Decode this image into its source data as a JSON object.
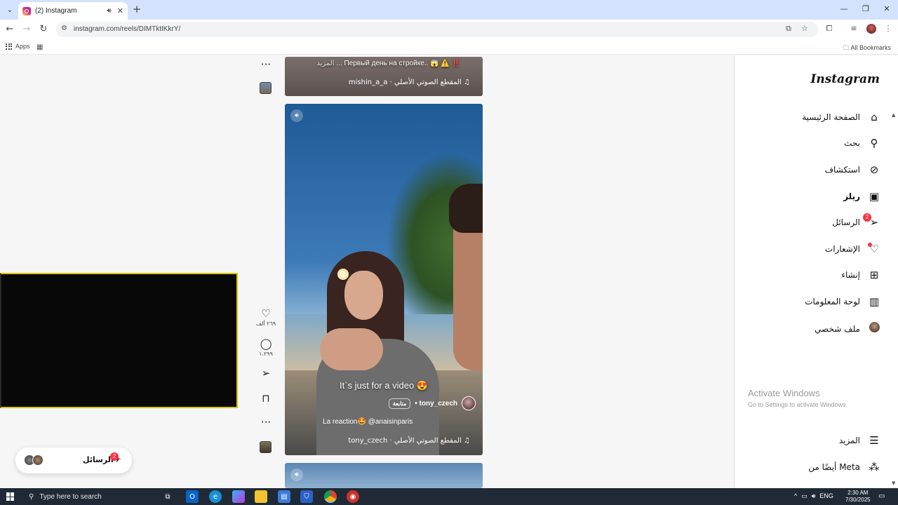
{
  "browser": {
    "tab_title": "(2) Instagram",
    "url": "instagram.com/reels/DIMTktIKkrY/",
    "bookmarks": {
      "apps_label": "Apps",
      "all_bookmarks_label": "All Bookmarks"
    }
  },
  "reels": {
    "previous": {
      "caption": "Первый день на стройке.. 😱 ⚠️ ‼️",
      "more_label": "المزيد ...",
      "audio": "mishin_a_a · المقطع الصوتي الأصلي ♫"
    },
    "current": {
      "overlay_text": "It`s just for a video 😍",
      "author": "tony_czech",
      "follow_label": "متابعة",
      "sub_caption": "La reaction🤩 @anaisinparis",
      "audio": "tony_czech · المقطع الصوتي الأصلي ♫",
      "likes": "٢٦٩ ألف",
      "comments": "١،٢٩٩"
    }
  },
  "sidebar": {
    "logo": "Instagram",
    "items": [
      {
        "label": "الصفحة الرئيسية",
        "icon": "home-icon"
      },
      {
        "label": "بحث",
        "icon": "search-icon"
      },
      {
        "label": "استكشاف",
        "icon": "explore-icon"
      },
      {
        "label": "ريلز",
        "icon": "reels-icon"
      },
      {
        "label": "الرسائل",
        "icon": "messages-icon",
        "badge": "2"
      },
      {
        "label": "الإشعارات",
        "icon": "heart-icon"
      },
      {
        "label": "إنشاء",
        "icon": "create-icon"
      },
      {
        "label": "لوحة المعلومات",
        "icon": "dashboard-icon"
      },
      {
        "label": "ملف شخصي",
        "icon": "profile-icon"
      },
      {
        "label": "المزيد",
        "icon": "menu-icon"
      },
      {
        "label": "أيضًا من Meta",
        "icon": "meta-icon"
      }
    ]
  },
  "messages_pill": {
    "label": "الرسائل",
    "badge": "2"
  },
  "watermark": {
    "title": "Activate Windows",
    "subtitle": "Go to Settings to activate Windows."
  },
  "taskbar": {
    "search_placeholder": "Type here to search",
    "lang": "ENG",
    "time": "2:30 AM",
    "date": "7/30/2025"
  },
  "colors": {
    "accent_badge": "#ff3040",
    "chrome_tab_strip": "#d3e3fd",
    "overlay_border": "#d8c400"
  }
}
